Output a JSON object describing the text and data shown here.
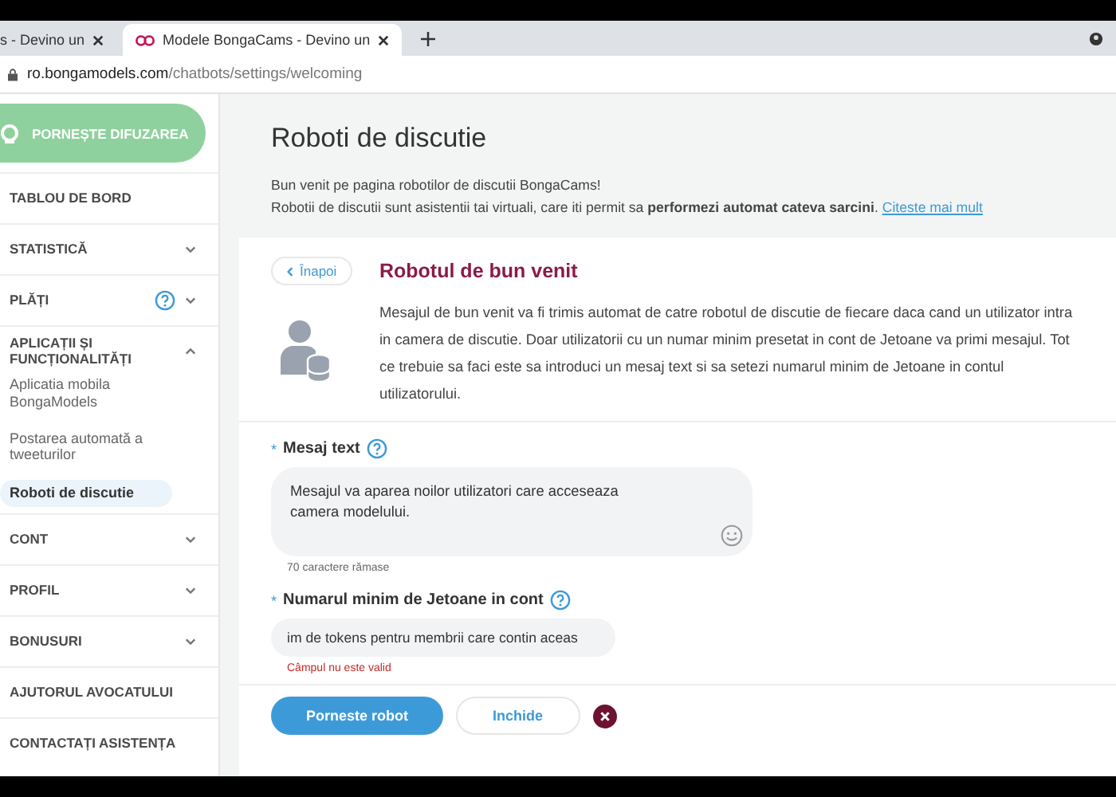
{
  "browser": {
    "tabs": [
      {
        "title": "s - Devino un",
        "selected": false
      },
      {
        "title": "Modele BongaCams - Devino un",
        "selected": true
      }
    ],
    "address": {
      "host": "ro.bongamodels.com",
      "path": "/chatbots/settings/welcoming"
    }
  },
  "sidebar": {
    "launch_button": "PORNEȘTE DIFUZAREA",
    "items": [
      {
        "label": "TABLOU DE BORD",
        "kind": "link",
        "help": false
      },
      {
        "label": "STATISTICĂ",
        "kind": "group",
        "expanded": false,
        "help": false
      },
      {
        "label": "PLĂȚI",
        "kind": "group",
        "expanded": false,
        "help": true
      },
      {
        "label": "APLICAȚII ȘI FUNCȚIONALITĂȚI",
        "kind": "group",
        "expanded": true,
        "help": false,
        "children": [
          {
            "label": "Aplicatia mobila BongaModels",
            "selected": false
          },
          {
            "label": "Postarea automată a tweeturilor",
            "selected": false
          },
          {
            "label": "Roboti de discutie",
            "selected": true
          }
        ]
      },
      {
        "label": "CONT",
        "kind": "group",
        "expanded": false,
        "help": false
      },
      {
        "label": "PROFIL",
        "kind": "group",
        "expanded": false,
        "help": false
      },
      {
        "label": "BONUSURI",
        "kind": "group",
        "expanded": false,
        "help": false
      },
      {
        "label": "AJUTORUL AVOCATULUI",
        "kind": "link",
        "help": false
      },
      {
        "label": "CONTACTAȚI ASISTENȚA",
        "kind": "link",
        "help": false
      }
    ]
  },
  "page": {
    "title": "Roboti de discutie",
    "intro": [
      "Bun venit pe pagina robotilor de discutii BongaCams!",
      "Robotii de discutii sunt asistentii tai virtuali, care iti permit sa **performezi automat cateva sarcini**."
    ],
    "intro_link": "Citeste mai mult"
  },
  "card": {
    "back_button": "Înapoi",
    "heading": "Robotul de bun venit",
    "description": "Mesajul de bun venit va fi trimis automat de catre robotul de discutie de fiecare daca cand un utilizator intra in camera de discutie. Doar utilizatorii cu un numar minim presetat in cont de Jetoane va primi mesajul. Tot ce trebuie sa faci este sa introduci un mesaj text si sa setezi numarul minim de Jetoane in contul utilizatorului.",
    "fields": [
      {
        "kind": "textarea",
        "marker": "*",
        "label": "Mesaj text",
        "help": true,
        "value": "Mesajul va aparea noilor utilizatori care acceseaza camera modelului.",
        "note": "70 caractere rămase"
      },
      {
        "kind": "input",
        "marker": "*",
        "label": "Numarul minim de Jetoane in cont",
        "help": true,
        "value": "im de tokens pentru membrii care contin aceas",
        "error": "Câmpul nu este valid"
      }
    ],
    "buttons": [
      {
        "label": "Porneste robot",
        "kind": "primary"
      },
      {
        "label": "Inchide",
        "kind": "secondary"
      }
    ]
  }
}
